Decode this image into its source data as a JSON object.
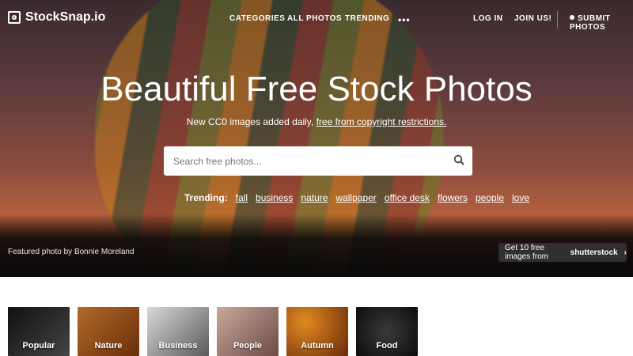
{
  "brand": {
    "name": "StockSnap.io"
  },
  "nav": {
    "links": [
      "CATEGORIES",
      "ALL PHOTOS",
      "TRENDING"
    ],
    "more": "•••",
    "right": [
      "LOG IN",
      "JOIN US!"
    ],
    "submit": "SUBMIT PHOTOS"
  },
  "hero": {
    "title": "Beautiful Free Stock Photos",
    "subtitle_prefix": "New CC0 images added daily,",
    "subtitle_link": "free from copyright restrictions.",
    "search": {
      "placeholder": "Search free photos..."
    },
    "trending": {
      "label": "Trending:",
      "tags": [
        "fall",
        "business",
        "nature",
        "wallpaper",
        "office desk",
        "flowers",
        "people",
        "love"
      ]
    },
    "credit_prefix": "Featured photo by",
    "credit_name": "Bonnie Moreland",
    "promo": {
      "text": "Get 10 free images from",
      "brand": "shutterstock",
      "chevron": "›"
    }
  },
  "categories": [
    "Popular",
    "Nature",
    "Business",
    "People",
    "Autumn",
    "Food"
  ],
  "colors": {
    "hero_accent": "#b5603e",
    "promo_bg": "#2f2f2f"
  }
}
